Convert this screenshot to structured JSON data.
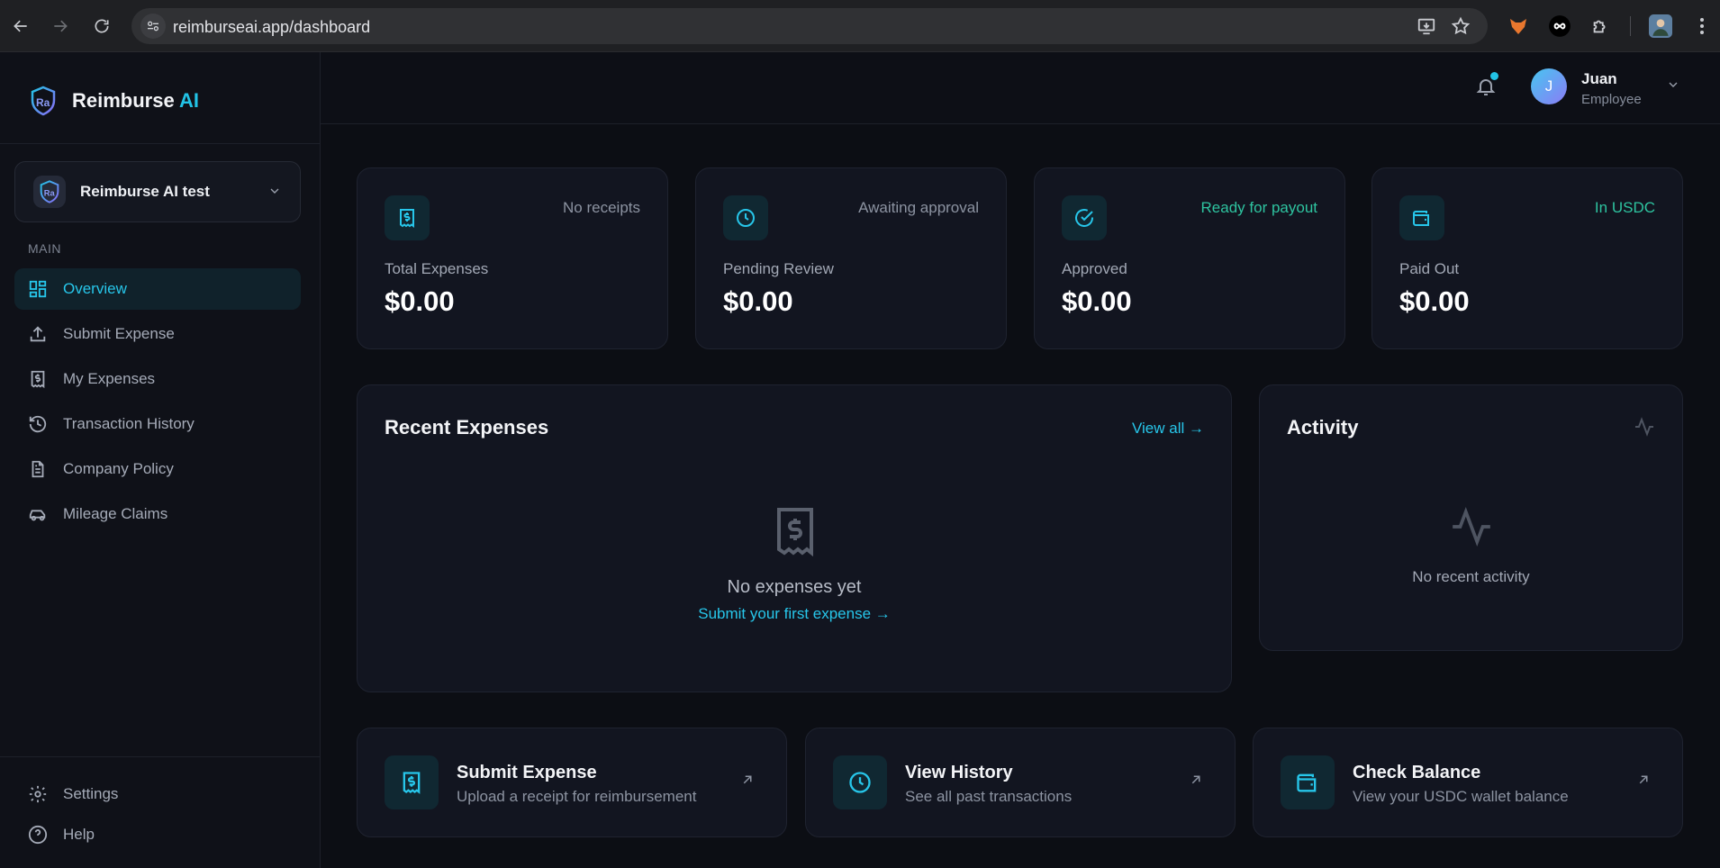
{
  "browser": {
    "url": "reimburseai.app/dashboard"
  },
  "brand": {
    "name_main": "Reimburse",
    "name_accent": "AI",
    "accent_color": "#22c3e6"
  },
  "org": {
    "name": "Reimburse AI test"
  },
  "sidebar": {
    "section_label": "MAIN",
    "items": [
      {
        "label": "Overview",
        "icon": "grid-icon",
        "active": true
      },
      {
        "label": "Submit Expense",
        "icon": "upload-icon"
      },
      {
        "label": "My Expenses",
        "icon": "receipt-icon"
      },
      {
        "label": "Transaction History",
        "icon": "history-icon"
      },
      {
        "label": "Company Policy",
        "icon": "document-icon"
      },
      {
        "label": "Mileage Claims",
        "icon": "car-icon"
      }
    ],
    "bottom_items": [
      {
        "label": "Settings",
        "icon": "gear-icon"
      },
      {
        "label": "Help",
        "icon": "help-icon"
      }
    ]
  },
  "user": {
    "initial": "J",
    "name": "Juan",
    "role": "Employee"
  },
  "stats": [
    {
      "label": "Total Expenses",
      "value": "$0.00",
      "note": "No receipts",
      "icon": "receipt-icon"
    },
    {
      "label": "Pending Review",
      "value": "$0.00",
      "note": "Awaiting approval",
      "icon": "clock-icon"
    },
    {
      "label": "Approved",
      "value": "$0.00",
      "note": "Ready for payout",
      "icon": "check-circle-icon"
    },
    {
      "label": "Paid Out",
      "value": "$0.00",
      "note": "In USDC",
      "icon": "wallet-icon"
    }
  ],
  "recent_expenses": {
    "title": "Recent Expenses",
    "view_all": "View all →",
    "empty_title": "No expenses yet",
    "empty_link": "Submit your first expense →"
  },
  "activity": {
    "title": "Activity",
    "empty_text": "No recent activity"
  },
  "actions": [
    {
      "title": "Submit Expense",
      "subtitle": "Upload a receipt for reimbursement",
      "icon": "receipt-icon"
    },
    {
      "title": "View History",
      "subtitle": "See all past transactions",
      "icon": "clock-icon"
    },
    {
      "title": "Check Balance",
      "subtitle": "View your USDC wallet balance",
      "icon": "wallet-icon"
    }
  ]
}
